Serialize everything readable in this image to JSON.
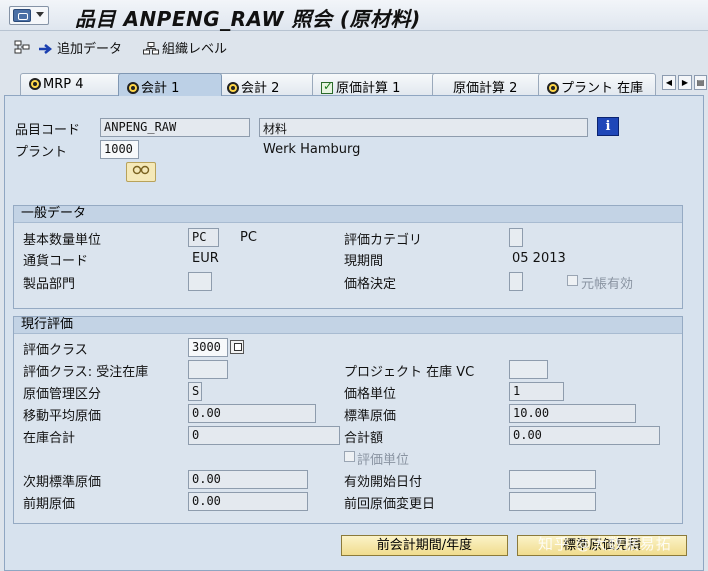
{
  "title": "品目 ANPENG_RAW 照会 (原材料)",
  "toolbar": {
    "add_data": "追加データ",
    "org_levels": "組織レベル"
  },
  "tabs": [
    {
      "label": "MRP 4",
      "icon": "status-icon"
    },
    {
      "label": "会計 1",
      "icon": "status-icon",
      "active": true
    },
    {
      "label": "会計 2",
      "icon": "status-icon"
    },
    {
      "label": "原価計算 1",
      "icon": "check-icon"
    },
    {
      "label": "原価計算 2",
      "icon": ""
    },
    {
      "label": "プラント 在庫",
      "icon": "status-icon"
    }
  ],
  "header": {
    "material_label": "品目コード",
    "material_value": "ANPENG_RAW",
    "material_desc": "材料",
    "plant_label": "プラント",
    "plant_value": "1000",
    "plant_desc": "Werk Hamburg"
  },
  "general": {
    "title": "一般データ",
    "base_uom_label": "基本数量単位",
    "base_uom_value": "PC",
    "base_uom_text": "PC",
    "valuation_category_label": "評価カテゴリ",
    "currency_label": "通貨コード",
    "currency_value": "EUR",
    "current_period_label": "現期間",
    "current_period_value": "05 2013",
    "division_label": "製品部門",
    "price_determination_label": "価格決定",
    "ml_active_label": "元帳有効"
  },
  "valuation": {
    "title": "現行評価",
    "valuation_class_label": "評価クラス",
    "valuation_class_value": "3000",
    "vc_sales_label": "評価クラス: 受注在庫",
    "vc_project_label": "プロジェクト 在庫 VC",
    "price_control_label": "原価管理区分",
    "price_control_value": "S",
    "price_unit_label": "価格単位",
    "price_unit_value": "1",
    "moving_price_label": "移動平均原価",
    "moving_price_value": "0.00",
    "standard_price_label": "標準原価",
    "standard_price_value": "10.00",
    "total_stock_label": "在庫合計",
    "total_stock_value": "0",
    "total_value_label": "合計額",
    "total_value_value": "0.00",
    "valuated_unit_label": "評価単位",
    "future_price_label": "次期標準原価",
    "future_price_value": "0.00",
    "valid_from_label": "有効開始日付",
    "prev_price_label": "前期原価",
    "prev_price_value": "0.00",
    "last_change_label": "前回原価変更日"
  },
  "buttons": {
    "prev_period": "前会計期間/年度",
    "std_cost_estimate": "標準原価見積"
  },
  "watermark": "知乎 @大数据易拓"
}
